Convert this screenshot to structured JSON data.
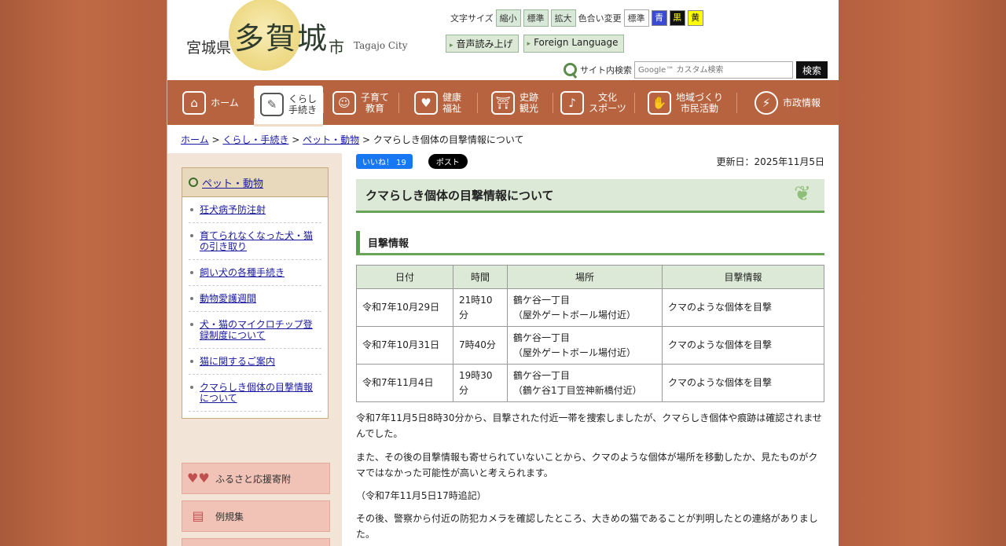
{
  "header": {
    "pref": "宮城県",
    "city": "多賀城",
    "shi": "市",
    "city_en": "Tagajo City",
    "font_size_label": "文字サイズ",
    "font_small": "縮小",
    "font_standard": "標準",
    "font_large": "拡大",
    "color_label": "色合い変更",
    "color_standard": "標準",
    "color_blue": "青",
    "color_black": "黒",
    "color_yellow": "黄",
    "read_aloud": "音声読み上げ",
    "foreign_language": "Foreign Language",
    "search_label": "サイト内検索",
    "search_placeholder": "Google™ カスタム検索",
    "search_button": "検索"
  },
  "nav": {
    "home": "ホーム",
    "living_1": "くらし",
    "living_2": "手続き",
    "child_1": "子育て",
    "child_2": "教育",
    "health_1": "健康",
    "health_2": "福祉",
    "history_1": "史跡",
    "history_2": "観光",
    "culture_1": "文化",
    "culture_2": "スポーツ",
    "community_1": "地域づくり",
    "community_2": "市民活動",
    "city_info": "市政情報"
  },
  "breadcrumb": {
    "home": "ホーム",
    "living": "くらし・手続き",
    "pets": "ペット・動物",
    "current": "クマらしき個体の目撃情報について",
    "sep": ">"
  },
  "sidebar": {
    "heading": "ペット・動物",
    "items": [
      "狂犬病予防注射",
      "育てられなくなった犬・猫の引き取り",
      "飼い犬の各種手続き",
      "動物愛護週間",
      "犬・猫のマイクロチップ登録制度について",
      "猫に関するご案内",
      "クマらしき個体の目撃情報について"
    ],
    "banner_furusato": "ふるさと応援寄附",
    "banner_reiki": "例規集"
  },
  "main": {
    "like_label": "いいね！ 19",
    "post_label": "ポスト",
    "updated": "更新日：2025年11月5日",
    "title": "クマらしき個体の目撃情報について",
    "section_title": "目撃情報",
    "table": {
      "headers": [
        "日付",
        "時間",
        "場所",
        "目撃情報"
      ],
      "rows": [
        {
          "date": "令和7年10月29日",
          "time": "21時10分",
          "place1": "鶴ケ谷一丁目",
          "place2": "（屋外ゲートボール場付近）",
          "info": "クマのような個体を目撃"
        },
        {
          "date": "令和7年10月31日",
          "time": "7時40分",
          "place1": "鶴ケ谷一丁目",
          "place2": "（屋外ゲートボール場付近）",
          "info": "クマのような個体を目撃"
        },
        {
          "date": "令和7年11月4日",
          "time": "19時30分",
          "place1": "鶴ケ谷一丁目",
          "place2": "（鶴ケ谷1丁目笠神新橋付近）",
          "info": "クマのような個体を目撃"
        }
      ]
    },
    "para1": "令和7年11月5日8時30分から、目撃された付近一帯を捜索しましたが、クマらしき個体や痕跡は確認されませんでした。",
    "para2": "また、その後の目撃情報も寄せられていないことから、クマのような個体が場所を移動したか、見たものがクマではなかった可能性が高いと考えられます。",
    "para3": "（令和7年11月5日17時追記）",
    "para4": "その後、警察から付近の防犯カメラを確認したところ、大きめの猫であることが判明したとの連絡がありました。"
  }
}
